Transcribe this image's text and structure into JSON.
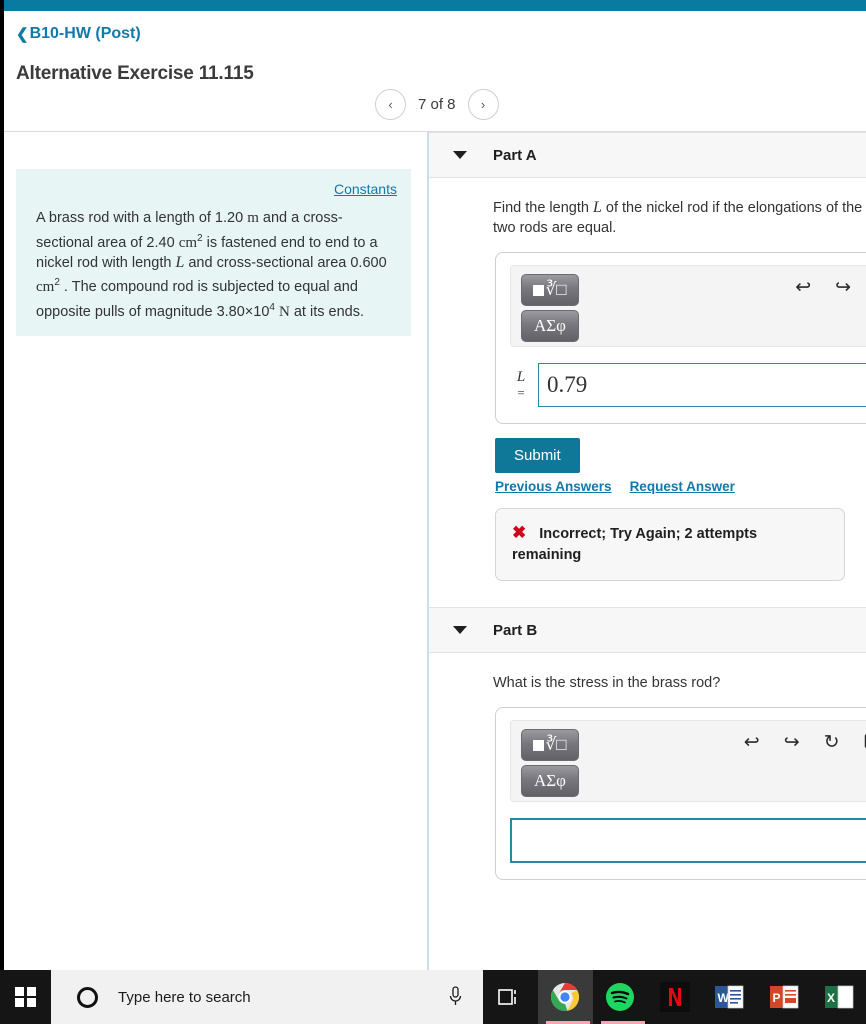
{
  "theme": {
    "teal": "#0a7ba0",
    "link": "#1279a8",
    "panel": "#e7f5f5",
    "error": "#d0021b",
    "submit": "#0f7899"
  },
  "header": {
    "breadcrumb_chevron": "chevron-left-icon",
    "breadcrumb": "B10-HW (Post)",
    "title": "Alternative Exercise 11.115",
    "pager": {
      "prev": "‹",
      "label": "7 of 8",
      "next": "›"
    }
  },
  "problem": {
    "constants_link": "Constants",
    "text_parts": {
      "p1": "A brass rod with a length of 1.20 ",
      "m": "m",
      "p2": " and a cross-sectional area of 2.40 ",
      "cm": "cm",
      "sup2a": "2",
      "p3": " is fastened end to end to a nickel rod with length ",
      "L": "L",
      "p4": " and cross-sectional area 0.600 ",
      "cm2": "cm",
      "sup2b": "2",
      "p5": " . The compound rod is subjected to equal and opposite pulls of magnitude 3.80×10",
      "sup4": "4",
      "p6": " ",
      "N": "N",
      "p7": " at its ends."
    }
  },
  "parts": [
    {
      "id": "part-a",
      "caret": "caret-down-icon",
      "label": "Part A",
      "question_pre": "Find the length ",
      "question_var": "L",
      "question_post": " of the nickel rod if the elongations of the two rods are equal.",
      "toolbar": {
        "template_button": "square-root-template-icon",
        "greek_button": "ΑΣφ",
        "undo": "undo-icon",
        "redo": "redo-icon",
        "reset": "reset-icon"
      },
      "answer": {
        "var": "L",
        "eq": "=",
        "value": "0.79",
        "placeholder": ""
      },
      "submit_label": "Submit",
      "links": [
        "Previous Answers",
        "Request Answer"
      ],
      "feedback": {
        "icon": "✖",
        "text": "Incorrect; Try Again; 2 attempts remaining"
      }
    },
    {
      "id": "part-b",
      "caret": "caret-down-icon",
      "label": "Part B",
      "question_pre": "What is the stress in the brass rod?",
      "question_var": "",
      "question_post": "",
      "toolbar": {
        "template_button": "square-root-template-icon",
        "greek_button": "ΑΣφ",
        "undo": "undo-icon",
        "redo": "redo-icon",
        "reset": "reset-icon",
        "keyboard": "keyboard-icon",
        "help": "?"
      },
      "answer": {
        "var": "",
        "eq": "",
        "value": "",
        "placeholder": ""
      }
    }
  ],
  "taskbar": {
    "start": "windows-start-icon",
    "search_placeholder": "Type here to search",
    "mic": "microphone-icon",
    "taskview": "task-view-icon",
    "apps": [
      {
        "name": "chrome",
        "label": "Chrome",
        "active": true
      },
      {
        "name": "spotify",
        "label": "Spotify",
        "active": false
      },
      {
        "name": "netflix",
        "label": "Netflix",
        "active": false
      },
      {
        "name": "word",
        "label": "Word",
        "active": false
      },
      {
        "name": "powerpoint",
        "label": "PowerPoint",
        "active": false
      },
      {
        "name": "excel",
        "label": "Excel",
        "active": false
      }
    ]
  }
}
